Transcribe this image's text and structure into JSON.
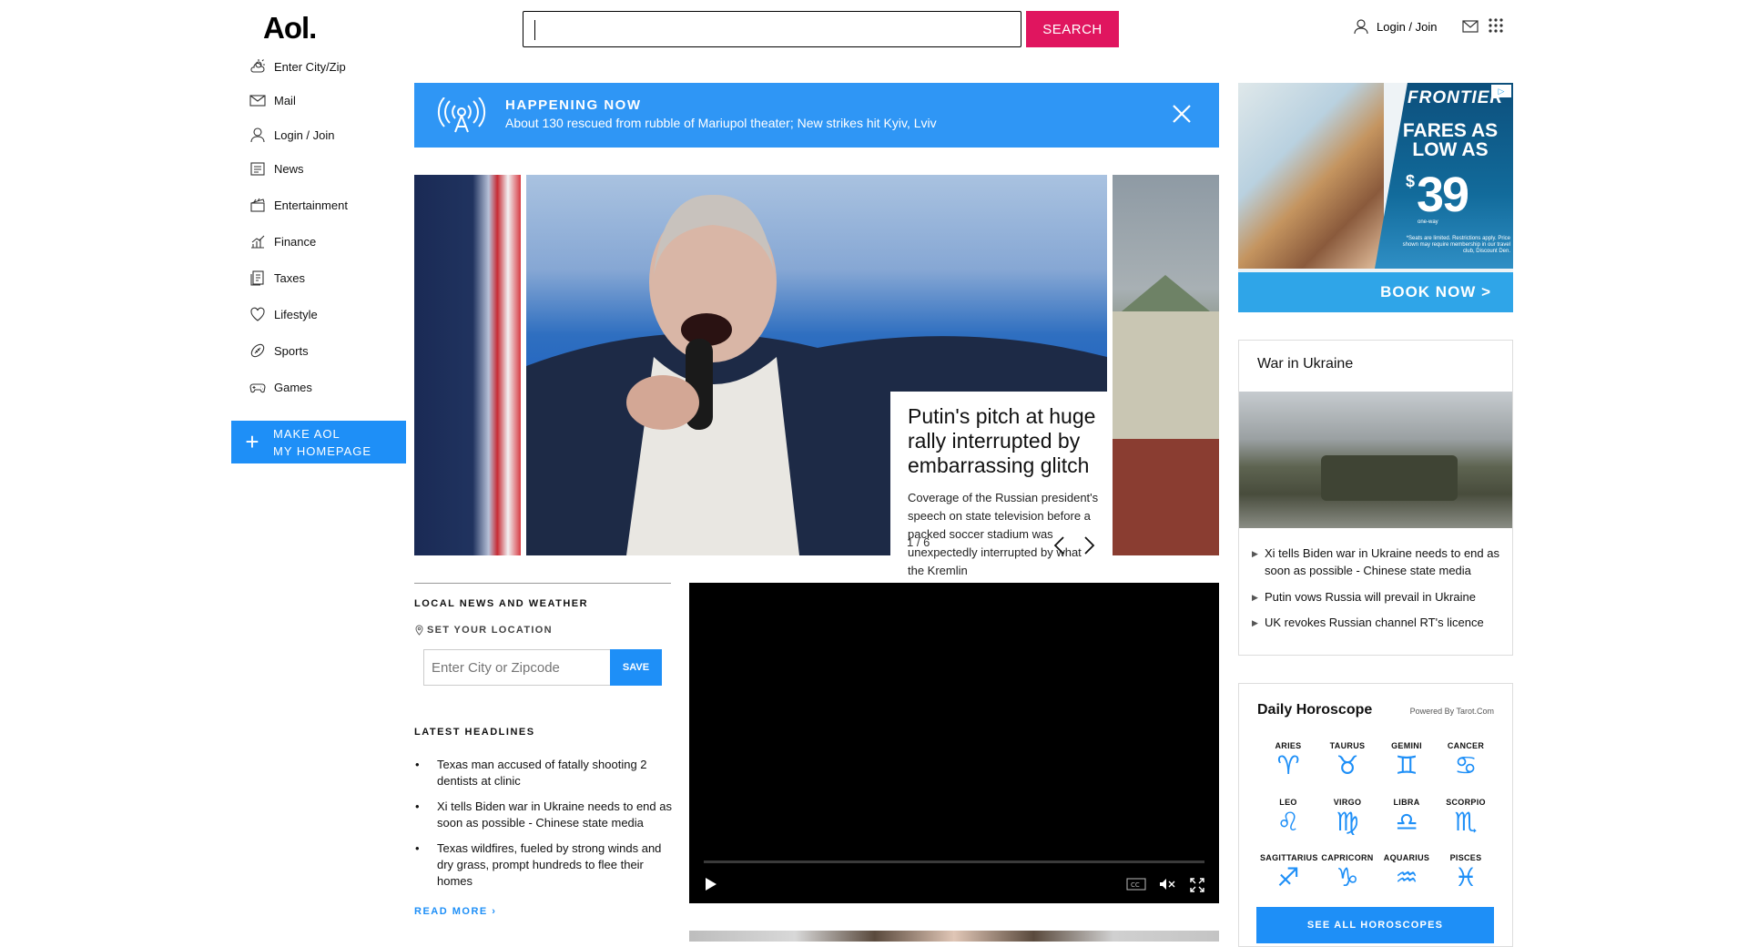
{
  "header": {
    "logo": "Aol.",
    "search_placeholder": "",
    "search_button": "SEARCH",
    "login_label": "Login / Join"
  },
  "nav": {
    "items": [
      {
        "label": "Enter City/Zip",
        "icon": "weather-icon"
      },
      {
        "label": "Mail",
        "icon": "mail-icon"
      },
      {
        "label": "Login / Join",
        "icon": "user-icon"
      },
      {
        "label": "News",
        "icon": "news-icon"
      },
      {
        "label": "Entertainment",
        "icon": "clapperboard-icon"
      },
      {
        "label": "Finance",
        "icon": "chart-icon"
      },
      {
        "label": "Taxes",
        "icon": "document-icon"
      },
      {
        "label": "Lifestyle",
        "icon": "heart-icon"
      },
      {
        "label": "Sports",
        "icon": "football-icon"
      },
      {
        "label": "Games",
        "icon": "gamepad-icon"
      }
    ],
    "make_home_line1": "MAKE AOL",
    "make_home_line2": "MY HOMEPAGE"
  },
  "happening": {
    "title": "HAPPENING NOW",
    "text": "About 130 rescued from rubble of Mariupol theater; New strikes hit Kyiv, Lviv"
  },
  "carousel": {
    "title": "Putin's pitch at huge rally interrupted by embarrassing glitch",
    "description": "Coverage of the Russian president's speech on state television before a packed soccer stadium was unexpectedly interrupted by what the Kremlin",
    "counter": "1 / 6"
  },
  "local": {
    "heading": "LOCAL NEWS AND WEATHER",
    "set_location": "SET YOUR LOCATION",
    "zip_placeholder": "Enter City or Zipcode",
    "save": "SAVE"
  },
  "latest": {
    "heading": "LATEST HEADLINES",
    "items": [
      "Texas man accused of fatally shooting 2 dentists at clinic",
      "Xi tells Biden war in Ukraine needs to end as soon as possible - Chinese state media",
      "Texas wildfires, fueled by strong winds and dry grass, prompt hundreds to flee their homes"
    ],
    "read_more": "READ MORE ›"
  },
  "ad": {
    "brand": "FRONTIER",
    "fares": "FARES AS LOW AS",
    "dollar": "$",
    "price": "39",
    "oneway": "one-way",
    "fine": "*Seats are limited. Restrictions apply. Price shown may require membership in our travel club, Discount Den.",
    "cta": "BOOK NOW >"
  },
  "war": {
    "title": "War in Ukraine",
    "links": [
      "Xi tells Biden war in Ukraine needs to end as soon as possible - Chinese state media",
      "Putin vows Russia will prevail in Ukraine",
      "UK revokes Russian channel RT's licence"
    ]
  },
  "horoscope": {
    "title": "Daily Horoscope",
    "powered": "Powered By Tarot.Com",
    "signs": [
      {
        "name": "ARIES",
        "glyph": "♈"
      },
      {
        "name": "TAURUS",
        "glyph": "♉"
      },
      {
        "name": "GEMINI",
        "glyph": "♊"
      },
      {
        "name": "CANCER",
        "glyph": "♋"
      },
      {
        "name": "LEO",
        "glyph": "♌"
      },
      {
        "name": "VIRGO",
        "glyph": "♍"
      },
      {
        "name": "LIBRA",
        "glyph": "♎"
      },
      {
        "name": "SCORPIO",
        "glyph": "♏"
      },
      {
        "name": "SAGITTARIUS",
        "glyph": "♐"
      },
      {
        "name": "CAPRICORN",
        "glyph": "♑"
      },
      {
        "name": "AQUARIUS",
        "glyph": "♒"
      },
      {
        "name": "PISCES",
        "glyph": "♓"
      }
    ],
    "button": "SEE ALL HOROSCOPES"
  },
  "colors": {
    "accent_blue": "#1e8ff7",
    "search_pink": "#e0155f",
    "banner_blue": "#2f96f5"
  }
}
